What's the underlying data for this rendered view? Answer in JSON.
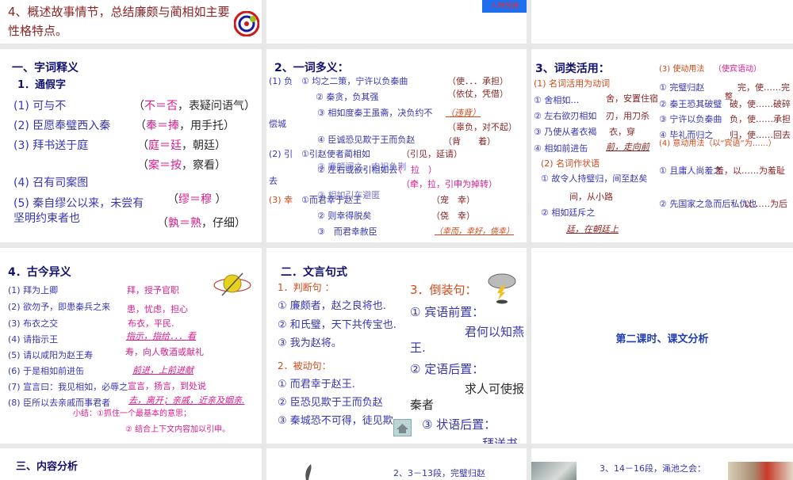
{
  "top_row": {
    "slide1": {
      "line1": "4、概述故事情节，总结廉颇与蔺相如主要",
      "line2": "性格特点。"
    },
    "slide2": {
      "button": "人物性格"
    }
  },
  "slide_tongjia": {
    "title": "一、字词释义",
    "subtitle": "1．通假字",
    "items": [
      "(1) 可与不",
      "(2) 臣愿奉璧西入秦",
      "(3) 拜书送于庭",
      "(4) 召有司案图",
      "(5) 秦自缪公以来，未尝有",
      "坚明约束者也"
    ],
    "notes": [
      {
        "open": "（",
        "key": "不＝否",
        "rest": "，表疑问语气）"
      },
      {
        "open": "（",
        "key": "奉＝捧",
        "rest": "，用手托）"
      },
      {
        "open": "（",
        "key": "庭＝廷",
        "rest": "，朝廷）"
      },
      {
        "open": "（",
        "key": "案＝按",
        "rest": "，察看）"
      },
      {
        "open": "（",
        "key": "缪＝穆",
        "rest": " ）"
      },
      {
        "open": "（",
        "key": "孰＝熟",
        "rest": "，仔细）"
      }
    ]
  },
  "slide_duoyi": {
    "title": "2、一词多义：",
    "t": [
      "(1) 负",
      "① 均之二策，宁许以负秦曲",
      "（使．．．承担）",
      "② 秦贪，负其强",
      "（依仗，凭借）",
      "③ 相如度秦王虽斋，决负约不",
      "（违背）",
      "偿城",
      "（辜负，对不起）",
      "④ 臣诚恐见欺于王而负赵",
      "（背　　着）",
      "(2) 引",
      "①引赵使者蔺相如",
      "（引见，延请）",
      "② 左右或欲引相如去",
      "③ 廉颇闻之，肉袒负荆",
      "（　拉　）",
      "去",
      "（牵，拉，引申为掉转）",
      "(3) 幸",
      "①而君幸于赵王",
      "③ 相如引车避匿",
      "（宠　幸）",
      "② 则幸得脱矣",
      "（侥　幸）",
      "③　而君幸赦臣",
      "（幸而，幸好，侥幸）"
    ]
  },
  "slide_huoyong": {
    "title": "3、词类活用：",
    "t": [
      "(1) 名词活用为动词",
      "① 舍相如…",
      "舍，安置住宿",
      "② 左右欲刃相如",
      "刃，用刀杀",
      "③ 乃使从者衣褐",
      "衣，穿",
      "④ 相如前进缶",
      "前，走向前",
      "(2) 名词作状语",
      "① 故令人持璧归，间至赵矣",
      "间，从小路",
      "② 相如廷斥之",
      "廷，在朝廷上",
      "(3) 使动用法",
      "（使宾语动）",
      "① 完璧归赵",
      "完，使……完",
      "② 秦王恐其破璧",
      "破，使……破碎",
      "③ 宁许以负秦曲",
      "负，使……承担",
      "④ 毕礼而归之",
      "归，使……回去",
      "(4) 意动用法（以“宾语”为……）",
      "① 且庸人尚羞之",
      "羞，以……为羞耻",
      "② 先国家之急而后私仇也",
      "以……为后",
      "整"
    ]
  },
  "slide_gujin": {
    "title": "4．古今异义",
    "items": [
      "(1) 拜为上卿",
      "(2) 欲勿予，即患秦兵之来",
      "(3) 布衣之交",
      "(4) 请指示王",
      "(5) 请以咸阳为赵王寿",
      "(6) 于是相如前进缶",
      "(7) 宣言曰：我见相如，必辱之",
      "(8) 臣所以去亲戚而事君者"
    ],
    "notes": [
      "拜，授予官职",
      "患，忧虑，担心",
      "布衣，平民.",
      "指示，指给．．．看",
      "寿，向人敬酒或献礼",
      "前进，上前进献",
      "宣言，扬言，到处说",
      "去，离开；亲戚，近亲及姻亲."
    ],
    "summary1": "小结：①抓住一个最基本的意思；",
    "summary2": "② 结合上下文内容加以引申。"
  },
  "slide_jushi": {
    "title": "二．文言句式",
    "t": [
      "1．判断句 ：",
      "① 廉颇者，赵之良将也.",
      "② 和氏璧，天下共传宝也.",
      "③ 我为赵将。",
      "2．被动句：",
      "① 而君幸于赵王.",
      "② 臣恐见欺于王而负赵",
      "③ 秦城恐不可得，徒见欺",
      "3．倒装句：",
      "① 宾语前置：",
      "君何以知燕",
      "王.",
      "② 定语后置：",
      "求人可使报",
      "秦者",
      "③ 状语后置：",
      "拜送书"
    ]
  },
  "slide_fenxi": {
    "title": "第二课时、课文分析"
  },
  "bottom_row": {
    "s1": "三、内容分析",
    "s2": "2、3－13段，完璧归赵",
    "s3": "3、14－16段，渑池之会："
  }
}
